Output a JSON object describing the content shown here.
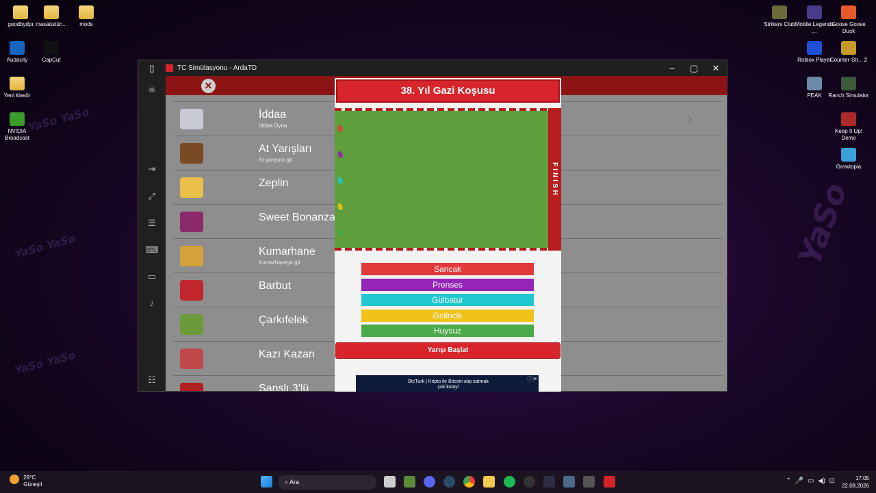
{
  "desktop_left": [
    {
      "name": "goodbydpı",
      "icon": "folder-icon"
    },
    {
      "name": "masaüstün...",
      "icon": "folder-icon"
    },
    {
      "name": "mods",
      "icon": "folder-icon"
    },
    {
      "name": "Audacity",
      "icon": "audacity-icon"
    },
    {
      "name": "CapCut",
      "icon": "capcut-icon"
    },
    {
      "name": "Yeni klasör",
      "icon": "folder-icon"
    },
    {
      "name": "NVIDIA Broadcast",
      "icon": "nvidia-icon"
    }
  ],
  "desktop_right": [
    {
      "name": "Strikers Club"
    },
    {
      "name": "Mobile Legends ..."
    },
    {
      "name": "Goose Goose Duck"
    },
    {
      "name": "Roblox Player"
    },
    {
      "name": "Counter-Str... 2"
    },
    {
      "name": "PEAK"
    },
    {
      "name": "Ranch Simulator"
    },
    {
      "name": "Keep It Up! Demo"
    },
    {
      "name": "Growtopia"
    }
  ],
  "window": {
    "title": "TC Simülasyonu - ArdaTD"
  },
  "menu": [
    {
      "title": "İddaa",
      "subtitle": "İddaa Oyna",
      "color": "#c9c9d6"
    },
    {
      "title": "At Yarışları",
      "subtitle": "At yarışına git",
      "color": "#7a4a22"
    },
    {
      "title": "Zeplin",
      "subtitle": "",
      "color": "#e8c04a"
    },
    {
      "title": "Sweet Bonanza",
      "subtitle": "",
      "color": "#8a2a6a"
    },
    {
      "title": "Kumarhane",
      "subtitle": "Kumarhaneye git",
      "color": "#d6a23a"
    },
    {
      "title": "Barbut",
      "subtitle": "",
      "color": "#c0262c"
    },
    {
      "title": "Çarkıfelek",
      "subtitle": "",
      "color": "#6a9a3a"
    },
    {
      "title": "Kazı Kazan",
      "subtitle": "",
      "color": "#c04a4a"
    },
    {
      "title": "Şanslı 3'lü",
      "subtitle": "",
      "color": "#b02020"
    }
  ],
  "race": {
    "title": "38. Yıl Gazi Koşusu",
    "finish_label": "FINISH",
    "horses": [
      {
        "name": "Sancak",
        "color": "#e23a3a"
      },
      {
        "name": "Prenses",
        "color": "#9524b8"
      },
      {
        "name": "Gülbatur",
        "color": "#1fc8cf"
      },
      {
        "name": "Gelincik",
        "color": "#f0c21a"
      },
      {
        "name": "Huysuz",
        "color": "#48aa48"
      }
    ],
    "start_button": "Yarışı Başlat"
  },
  "ad": {
    "text": "BtcTurk | Kripto ile Bitcoin alıp satmak çok kolay!"
  },
  "taskbar": {
    "weather_temp": "29°C",
    "weather_desc": "Güneşli",
    "search_placeholder": "Ara",
    "time": "17:05",
    "date": "22.08.2026"
  }
}
